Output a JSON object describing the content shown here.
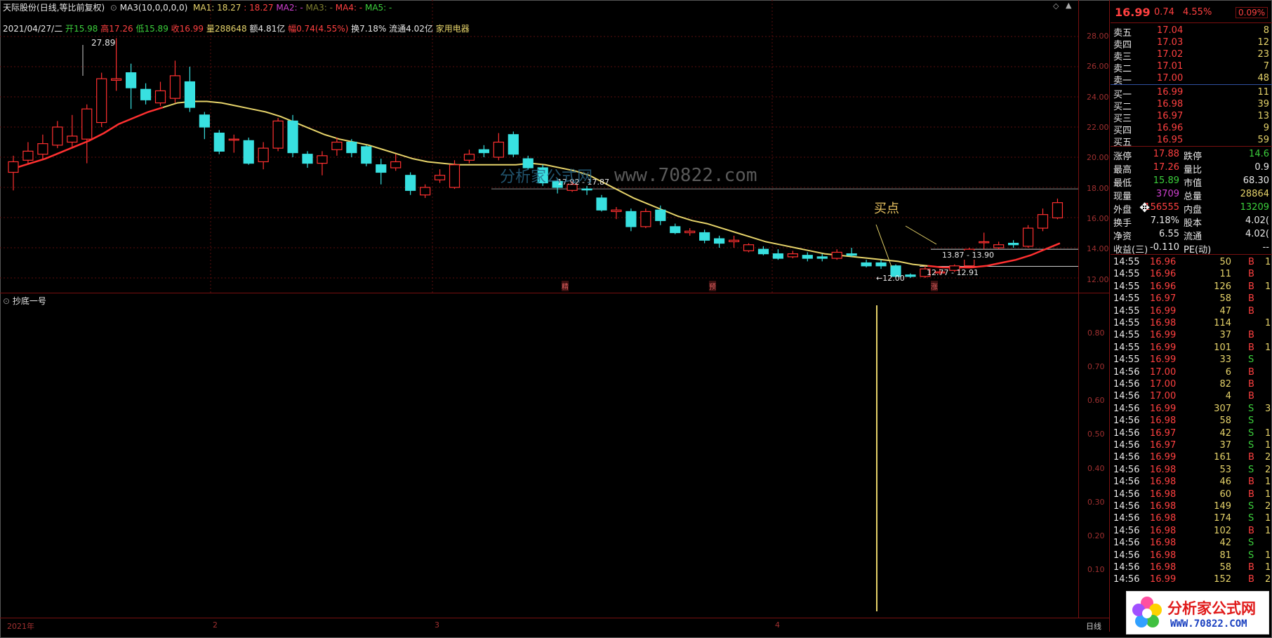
{
  "header": {
    "stock_name": "天际股份",
    "mode": "(日线,等比前复权)",
    "ma3_label": "MA3(10,0,0,0,0)",
    "ma1": "MA1: 18.27",
    "ma1_value": ": 18.27",
    "ma2": "MA2: -",
    "ma3": "MA3: -",
    "ma4": "MA4: -",
    "ma5": "MA5: -"
  },
  "info_line": {
    "date": "2021/04/27/二",
    "open_label": "开",
    "open": "15.98",
    "high_label": "高",
    "high": "17.26",
    "low_label": "低",
    "low": "15.89",
    "close_label": "收",
    "close": "16.99",
    "vol_label": "量",
    "vol": "288648",
    "amount_label": "额",
    "amount": "4.81亿",
    "amp_label": "幅",
    "amp": "0.74(4.55%)",
    "turnover_label": "换",
    "turnover": "7.18%",
    "float_label": "流通",
    "float": "4.02亿",
    "industry": "家用电器"
  },
  "price_ticks": [
    "28.00",
    "26.00",
    "24.00",
    "22.00",
    "20.00",
    "18.00",
    "16.00",
    "14.00",
    "12.00"
  ],
  "sub_ticks": [
    "0.80",
    "0.70",
    "0.60",
    "0.50",
    "0.40",
    "0.30",
    "0.20",
    "0.10"
  ],
  "annotations": {
    "peak": "27.89",
    "mid_range": "17.92 - 17.87",
    "buy_point": "买点",
    "range1": "13.87 - 13.90",
    "range2": "12.77 - 12.91",
    "low": "12.00",
    "mark1": "精",
    "mark2": "预",
    "mark3": "涨",
    "watermark": "www.70822.com",
    "watermark_cn": "分析家公式网"
  },
  "indicator": {
    "name": "抄底一号"
  },
  "x_axis": {
    "labels": [
      "2021年",
      "2",
      "3",
      "4"
    ],
    "period": "日线"
  },
  "quote": {
    "price": "16.99",
    "change": "0.74",
    "pct": "4.55%",
    "badge": "0.09%"
  },
  "asks": [
    {
      "label": "卖五",
      "price": "17.04",
      "vol": "8"
    },
    {
      "label": "卖四",
      "price": "17.03",
      "vol": "12"
    },
    {
      "label": "卖三",
      "price": "17.02",
      "vol": "23"
    },
    {
      "label": "卖二",
      "price": "17.01",
      "vol": "7"
    },
    {
      "label": "卖一",
      "price": "17.00",
      "vol": "48"
    }
  ],
  "bids": [
    {
      "label": "买一",
      "price": "16.99",
      "vol": "11"
    },
    {
      "label": "买二",
      "price": "16.98",
      "vol": "39"
    },
    {
      "label": "买三",
      "price": "16.97",
      "vol": "13"
    },
    {
      "label": "买四",
      "price": "16.96",
      "vol": "9"
    },
    {
      "label": "买五",
      "price": "16.95",
      "vol": "59"
    }
  ],
  "stats": [
    {
      "l1": "涨停",
      "v1": "17.88",
      "l2": "跌停",
      "v2": "14.6"
    },
    {
      "l1": "最高",
      "v1": "17.26",
      "l2": "量比",
      "v2": "0.9"
    },
    {
      "l1": "最低",
      "v1": "15.89",
      "l2": "市值",
      "v2": "68.30"
    },
    {
      "l1": "现量",
      "v1": "3709",
      "l2": "总量",
      "v2": "28864"
    },
    {
      "l1": "外盘",
      "v1": "156555",
      "l2": "内盘",
      "v2": "13209"
    },
    {
      "l1": "换手",
      "v1": "7.18%",
      "l2": "股本",
      "v2": "4.02("
    },
    {
      "l1": "净资",
      "v1": "6.55",
      "l2": "流通",
      "v2": "4.02("
    },
    {
      "l1": "收益(三)",
      "v1": "-0.110",
      "l2": "PE(动)",
      "v2": "--"
    }
  ],
  "ticks": [
    {
      "t": "14:55",
      "p": "16.96",
      "v": "50",
      "s": "B",
      "n": "1"
    },
    {
      "t": "14:55",
      "p": "16.96",
      "v": "11",
      "s": "B",
      "n": ""
    },
    {
      "t": "14:55",
      "p": "16.96",
      "v": "126",
      "s": "B",
      "n": "1"
    },
    {
      "t": "14:55",
      "p": "16.97",
      "v": "58",
      "s": "B",
      "n": ""
    },
    {
      "t": "14:55",
      "p": "16.99",
      "v": "47",
      "s": "B",
      "n": ""
    },
    {
      "t": "14:55",
      "p": "16.98",
      "v": "114",
      "s": "",
      "n": "1"
    },
    {
      "t": "14:55",
      "p": "16.99",
      "v": "37",
      "s": "B",
      "n": ""
    },
    {
      "t": "14:55",
      "p": "16.99",
      "v": "101",
      "s": "B",
      "n": "1"
    },
    {
      "t": "14:55",
      "p": "16.99",
      "v": "33",
      "s": "S",
      "n": ""
    },
    {
      "t": "14:56",
      "p": "17.00",
      "v": "6",
      "s": "B",
      "n": ""
    },
    {
      "t": "14:56",
      "p": "17.00",
      "v": "82",
      "s": "B",
      "n": ""
    },
    {
      "t": "14:56",
      "p": "17.00",
      "v": "4",
      "s": "B",
      "n": ""
    },
    {
      "t": "14:56",
      "p": "16.99",
      "v": "307",
      "s": "S",
      "n": "3"
    },
    {
      "t": "14:56",
      "p": "16.98",
      "v": "58",
      "s": "S",
      "n": ""
    },
    {
      "t": "14:56",
      "p": "16.97",
      "v": "42",
      "s": "S",
      "n": "1"
    },
    {
      "t": "14:56",
      "p": "16.97",
      "v": "37",
      "s": "S",
      "n": "1"
    },
    {
      "t": "14:56",
      "p": "16.99",
      "v": "161",
      "s": "B",
      "n": "2"
    },
    {
      "t": "14:56",
      "p": "16.98",
      "v": "53",
      "s": "S",
      "n": "2"
    },
    {
      "t": "14:56",
      "p": "16.98",
      "v": "46",
      "s": "B",
      "n": "1"
    },
    {
      "t": "14:56",
      "p": "16.98",
      "v": "60",
      "s": "B",
      "n": "1"
    },
    {
      "t": "14:56",
      "p": "16.98",
      "v": "149",
      "s": "S",
      "n": "2"
    },
    {
      "t": "14:56",
      "p": "16.98",
      "v": "174",
      "s": "S",
      "n": "1"
    },
    {
      "t": "14:56",
      "p": "16.98",
      "v": "102",
      "s": "B",
      "n": "1"
    },
    {
      "t": "14:56",
      "p": "16.98",
      "v": "42",
      "s": "S",
      "n": ""
    },
    {
      "t": "14:56",
      "p": "16.98",
      "v": "81",
      "s": "S",
      "n": "1"
    },
    {
      "t": "14:56",
      "p": "16.98",
      "v": "58",
      "s": "B",
      "n": "1"
    },
    {
      "t": "14:56",
      "p": "16.99",
      "v": "152",
      "s": "B",
      "n": "2"
    }
  ],
  "logo": {
    "title": "分析家公式网",
    "url": "WWW.70822.COM"
  },
  "colors": {
    "up": "#ff3030",
    "down": "#38e0e0",
    "ma": "#e6d36a",
    "grid": "#5a0e0e",
    "axis": "#7a1010"
  },
  "chart_data": {
    "type": "candlestick",
    "candles": [
      {
        "o": 19.0,
        "c": 19.7,
        "h": 20.1,
        "l": 17.8
      },
      {
        "o": 19.8,
        "c": 20.4,
        "h": 21.0,
        "l": 19.5
      },
      {
        "o": 20.2,
        "c": 20.9,
        "h": 21.5,
        "l": 19.9
      },
      {
        "o": 20.8,
        "c": 22.0,
        "h": 22.4,
        "l": 20.6
      },
      {
        "o": 21.0,
        "c": 21.4,
        "h": 22.8,
        "l": 20.7
      },
      {
        "o": 21.2,
        "c": 23.2,
        "h": 23.5,
        "l": 19.6
      },
      {
        "o": 22.3,
        "c": 25.2,
        "h": 25.6,
        "l": 22.0
      },
      {
        "o": 25.1,
        "c": 25.2,
        "h": 27.89,
        "l": 24.4
      },
      {
        "o": 25.6,
        "c": 24.6,
        "h": 26.2,
        "l": 23.2
      },
      {
        "o": 24.5,
        "c": 23.8,
        "h": 24.9,
        "l": 23.5
      },
      {
        "o": 23.6,
        "c": 24.4,
        "h": 25.0,
        "l": 23.4
      },
      {
        "o": 23.9,
        "c": 25.4,
        "h": 26.4,
        "l": 23.6
      },
      {
        "o": 25.0,
        "c": 23.3,
        "h": 26.0,
        "l": 23.0
      },
      {
        "o": 22.8,
        "c": 22.0,
        "h": 23.0,
        "l": 21.2
      },
      {
        "o": 21.6,
        "c": 20.4,
        "h": 21.8,
        "l": 20.2
      },
      {
        "o": 21.2,
        "c": 21.2,
        "h": 21.5,
        "l": 20.3
      },
      {
        "o": 21.1,
        "c": 19.6,
        "h": 21.3,
        "l": 19.5
      },
      {
        "o": 19.7,
        "c": 20.6,
        "h": 21.0,
        "l": 19.2
      },
      {
        "o": 20.6,
        "c": 22.4,
        "h": 22.6,
        "l": 20.4
      },
      {
        "o": 22.4,
        "c": 20.3,
        "h": 22.8,
        "l": 20.0
      },
      {
        "o": 20.2,
        "c": 19.6,
        "h": 20.4,
        "l": 19.3
      },
      {
        "o": 19.6,
        "c": 20.1,
        "h": 20.4,
        "l": 18.8
      },
      {
        "o": 20.5,
        "c": 21.0,
        "h": 21.3,
        "l": 20.1
      },
      {
        "o": 21.0,
        "c": 20.3,
        "h": 21.2,
        "l": 20.0
      },
      {
        "o": 20.7,
        "c": 19.6,
        "h": 20.8,
        "l": 19.4
      },
      {
        "o": 19.5,
        "c": 19.0,
        "h": 19.9,
        "l": 18.2
      },
      {
        "o": 19.3,
        "c": 19.7,
        "h": 20.2,
        "l": 19.1
      },
      {
        "o": 18.8,
        "c": 17.8,
        "h": 19.0,
        "l": 17.5
      },
      {
        "o": 17.5,
        "c": 18.0,
        "h": 18.2,
        "l": 17.3
      },
      {
        "o": 18.5,
        "c": 18.8,
        "h": 19.2,
        "l": 18.3
      },
      {
        "o": 18.0,
        "c": 19.5,
        "h": 19.8,
        "l": 17.9
      },
      {
        "o": 19.8,
        "c": 20.2,
        "h": 20.5,
        "l": 19.6
      },
      {
        "o": 20.5,
        "c": 20.3,
        "h": 20.8,
        "l": 20.0
      },
      {
        "o": 20.0,
        "c": 21.0,
        "h": 21.6,
        "l": 19.8
      },
      {
        "o": 21.5,
        "c": 20.2,
        "h": 21.7,
        "l": 20.0
      },
      {
        "o": 19.9,
        "c": 19.3,
        "h": 20.1,
        "l": 19.2
      },
      {
        "o": 19.3,
        "c": 18.3,
        "h": 19.5,
        "l": 18.1
      },
      {
        "o": 18.4,
        "c": 18.0,
        "h": 18.6,
        "l": 17.6
      },
      {
        "o": 17.8,
        "c": 18.2,
        "h": 18.4,
        "l": 17.7
      },
      {
        "o": 17.9,
        "c": 17.87,
        "h": 18.1,
        "l": 17.5
      },
      {
        "o": 17.3,
        "c": 16.5,
        "h": 17.5,
        "l": 16.4
      },
      {
        "o": 16.4,
        "c": 16.5,
        "h": 16.7,
        "l": 15.9
      },
      {
        "o": 16.4,
        "c": 15.4,
        "h": 16.6,
        "l": 15.1
      },
      {
        "o": 15.4,
        "c": 16.4,
        "h": 16.6,
        "l": 15.3
      },
      {
        "o": 16.5,
        "c": 15.8,
        "h": 16.8,
        "l": 15.5
      },
      {
        "o": 15.4,
        "c": 15.0,
        "h": 15.6,
        "l": 14.9
      },
      {
        "o": 15.0,
        "c": 15.1,
        "h": 15.3,
        "l": 14.8
      },
      {
        "o": 15.0,
        "c": 14.5,
        "h": 15.2,
        "l": 14.3
      },
      {
        "o": 14.6,
        "c": 14.3,
        "h": 14.8,
        "l": 14.0
      },
      {
        "o": 14.4,
        "c": 14.5,
        "h": 14.8,
        "l": 14.0
      },
      {
        "o": 13.8,
        "c": 14.2,
        "h": 14.3,
        "l": 13.7
      },
      {
        "o": 13.9,
        "c": 13.6,
        "h": 14.1,
        "l": 13.5
      },
      {
        "o": 13.6,
        "c": 13.3,
        "h": 13.9,
        "l": 13.2
      },
      {
        "o": 13.4,
        "c": 13.6,
        "h": 13.8,
        "l": 13.3
      },
      {
        "o": 13.5,
        "c": 13.3,
        "h": 13.7,
        "l": 13.1
      },
      {
        "o": 13.4,
        "c": 13.3,
        "h": 13.6,
        "l": 13.1
      },
      {
        "o": 13.3,
        "c": 13.7,
        "h": 13.9,
        "l": 13.2
      },
      {
        "o": 13.6,
        "c": 13.5,
        "h": 14.0,
        "l": 13.4
      },
      {
        "o": 13.0,
        "c": 12.8,
        "h": 13.2,
        "l": 12.7
      },
      {
        "o": 13.0,
        "c": 12.8,
        "h": 13.2,
        "l": 12.6
      },
      {
        "o": 12.8,
        "c": 12.1,
        "h": 12.9,
        "l": 12.0
      },
      {
        "o": 12.2,
        "c": 12.1,
        "h": 12.3,
        "l": 12.0
      },
      {
        "o": 12.1,
        "c": 12.6,
        "h": 12.8,
        "l": 12.0
      },
      {
        "o": 12.4,
        "c": 12.4,
        "h": 12.6,
        "l": 12.2
      },
      {
        "o": 12.5,
        "c": 12.8,
        "h": 12.9,
        "l": 12.4
      },
      {
        "o": 12.8,
        "c": 13.9,
        "h": 14.0,
        "l": 12.77
      },
      {
        "o": 14.4,
        "c": 14.4,
        "h": 15.0,
        "l": 13.9
      },
      {
        "o": 14.0,
        "c": 14.2,
        "h": 14.4,
        "l": 13.9
      },
      {
        "o": 14.3,
        "c": 14.2,
        "h": 14.5,
        "l": 14.0
      },
      {
        "o": 14.1,
        "c": 15.3,
        "h": 15.5,
        "l": 14.0
      },
      {
        "o": 15.3,
        "c": 16.2,
        "h": 16.6,
        "l": 15.1
      },
      {
        "o": 15.98,
        "c": 16.99,
        "h": 17.26,
        "l": 15.89
      }
    ],
    "ma": [
      19.3,
      19.6,
      19.9,
      20.3,
      20.7,
      21.1,
      21.6,
      22.2,
      22.6,
      23.0,
      23.3,
      23.6,
      23.7,
      23.7,
      23.6,
      23.4,
      23.2,
      23.0,
      22.7,
      22.3,
      21.9,
      21.5,
      21.2,
      21.0,
      20.8,
      20.5,
      20.2,
      19.9,
      19.7,
      19.6,
      19.5,
      19.5,
      19.5,
      19.5,
      19.5,
      19.6,
      19.5,
      19.3,
      19.1,
      18.8,
      18.3,
      17.8,
      17.3,
      16.9,
      16.5,
      16.1,
      15.8,
      15.6,
      15.3,
      15.0,
      14.7,
      14.4,
      14.2,
      14.0,
      13.8,
      13.6,
      13.5,
      13.4,
      13.3,
      13.2,
      13.1,
      12.9,
      12.8,
      12.7,
      12.7,
      12.7,
      12.8,
      13.0,
      13.2,
      13.5,
      13.9,
      14.3
    ],
    "ylim": [
      11.0,
      29.0
    ],
    "indicator_values": [
      {
        "index": 60,
        "value": 0.9
      }
    ]
  }
}
